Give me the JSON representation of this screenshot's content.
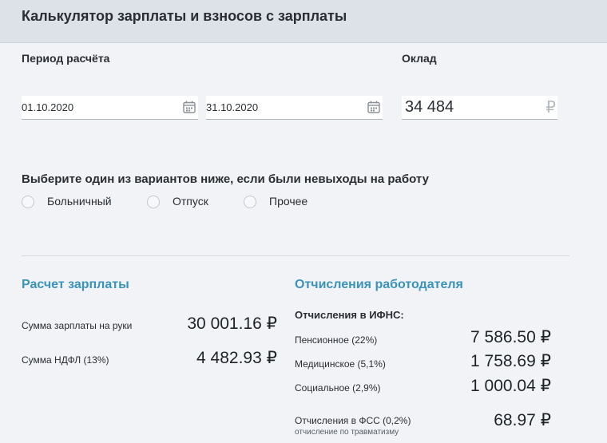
{
  "header": {
    "title": "Калькулятор зарплаты и взносов с зарплаты"
  },
  "period": {
    "label": "Период расчёта",
    "start_date": "01.10.2020",
    "end_date": "31.10.2020"
  },
  "salary": {
    "label": "Оклад",
    "value": "34 484",
    "currency": "₽"
  },
  "absence": {
    "prompt": "Выберите один из вариантов ниже, если были невыходы на работу",
    "options": [
      {
        "label": "Больничный",
        "selected": false
      },
      {
        "label": "Отпуск",
        "selected": false
      },
      {
        "label": "Прочее",
        "selected": false
      }
    ]
  },
  "salary_calc": {
    "title": "Расчет зарплаты",
    "rows": [
      {
        "label": "Сумма зарплаты на руки",
        "amount": "30 001.16 ₽"
      },
      {
        "label": "Сумма НДФЛ (13%)",
        "amount": "4 482.93 ₽"
      }
    ]
  },
  "employer": {
    "title": "Отчисления работодателя",
    "ifns_title": "Отчисления в ИФНС:",
    "rows": [
      {
        "label": "Пенсионное (22%)",
        "amount": "7 586.50 ₽"
      },
      {
        "label": "Медицинское (5,1%)",
        "amount": "1 758.69 ₽"
      },
      {
        "label": "Социальное (2,9%)",
        "amount": "1 000.04 ₽"
      }
    ],
    "fss": {
      "label": "Отчисления в ФСС (0,2%)",
      "sublabel": "отчисление по травматизму",
      "amount": "68.97 ₽"
    }
  },
  "colors": {
    "accent": "#3a93b8",
    "header_bg": "#dde2e9",
    "page_bg": "#f1f3f6"
  },
  "icons": {
    "date_picker": "calendar-icon"
  }
}
